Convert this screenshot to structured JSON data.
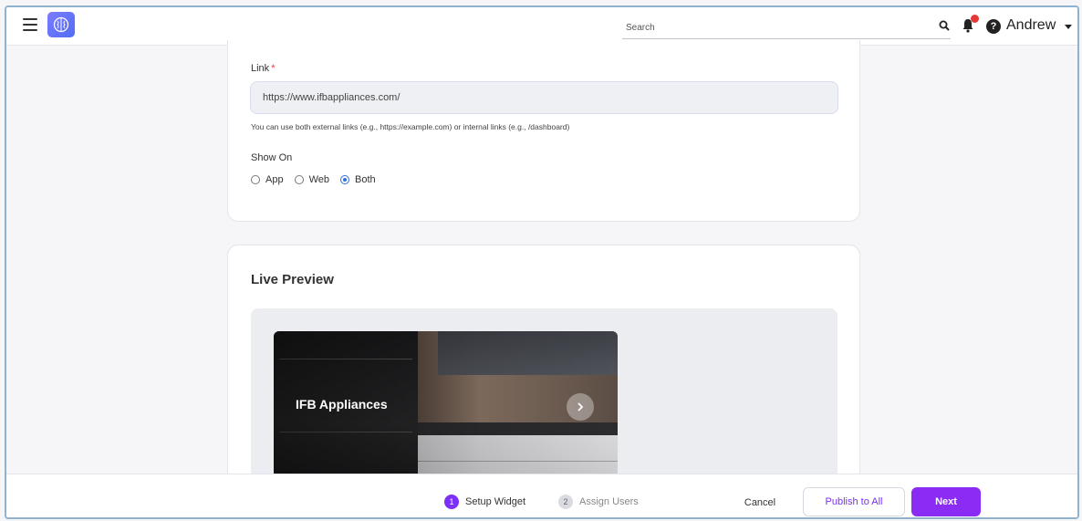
{
  "header": {
    "search": {
      "placeholder": "Search"
    },
    "user": {
      "name": "Andrew"
    },
    "icons": [
      "menu-icon",
      "brain-logo-icon",
      "search-icon",
      "bell-icon",
      "help-icon",
      "caret-down-icon"
    ],
    "colors": {
      "notification_dot": "#e53935",
      "logo": "#5b6cf6"
    }
  },
  "form": {
    "link_label": "Link",
    "required_marker": "*",
    "link_value": "https://www.ifbappliances.com/",
    "link_helper": "You can use both external links (e.g., https://example.com) or internal links (e.g., /dashboard)",
    "show_on_label": "Show On",
    "show_on_options": [
      {
        "label": "App",
        "selected": false
      },
      {
        "label": "Web",
        "selected": false
      },
      {
        "label": "Both",
        "selected": true
      }
    ]
  },
  "preview": {
    "title": "Live Preview",
    "banner_title": "IFB Appliances",
    "icons": [
      "chevron-right-icon"
    ]
  },
  "footer": {
    "steps": [
      {
        "number": "1",
        "label": "Setup Widget",
        "active": true
      },
      {
        "number": "2",
        "label": "Assign Users",
        "active": false
      }
    ],
    "cancel_label": "Cancel",
    "publish_label": "Publish to All",
    "next_label": "Next",
    "colors": {
      "accent": "#8b2cf5"
    }
  }
}
